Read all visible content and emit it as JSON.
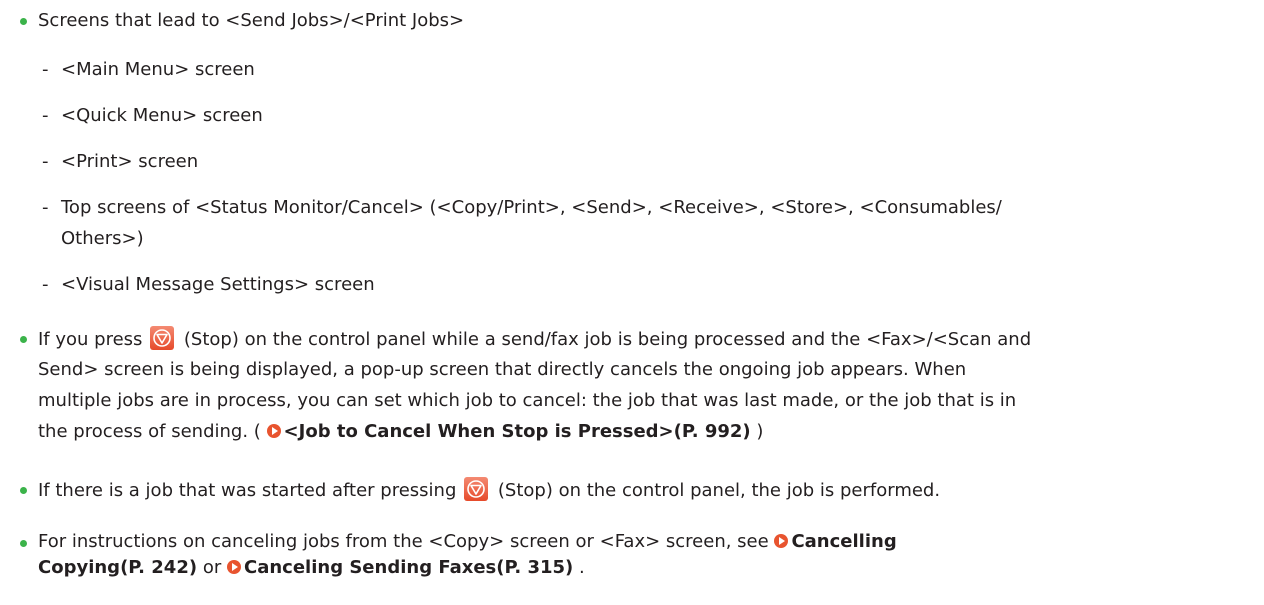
{
  "colors": {
    "bullet": "#3bb34a",
    "link_icon": "#e8542f",
    "stop_button": "#e64a2a"
  },
  "items": [
    {
      "text": "Screens that lead to <Send Jobs>/<Print Jobs>",
      "sub": [
        "<Main Menu> screen",
        "<Quick Menu> screen",
        "<Print> screen",
        "Top screens of <Status Monitor/Cancel> (<Copy/Print>, <Send>, <Receive>, <Store>, <Consumables/",
        "Others>)",
        "<Visual Message Settings> screen"
      ],
      "dash": "-"
    },
    {
      "l1a": "If you press",
      "l1b": "(Stop) on the control panel while a send/fax job is being processed and the <Fax>/<Scan and",
      "l2": "Send> screen is being displayed, a pop-up screen that directly cancels the ongoing job appears. When",
      "l3": "multiple jobs are in process, you can set which job to cancel: the job that was last made, or the job that is in",
      "l4a": "the process of sending. (",
      "link": "<Job to Cancel When Stop is Pressed>(P. 992)",
      "l4b": ")"
    },
    {
      "a": "If there is a job that was started after pressing",
      "b": "(Stop) on the control panel, the job is performed."
    },
    {
      "a": "For instructions on canceling jobs from the <Copy> screen or <Fax> screen, see",
      "link1a": "Cancelling",
      "link1b": "Copying(P. 242)",
      "mid": "or",
      "link2": "Canceling Sending Faxes(P. 315)",
      "end": "."
    }
  ],
  "icons": {
    "stop": "stop-button-icon",
    "link": "link-arrow-icon"
  }
}
